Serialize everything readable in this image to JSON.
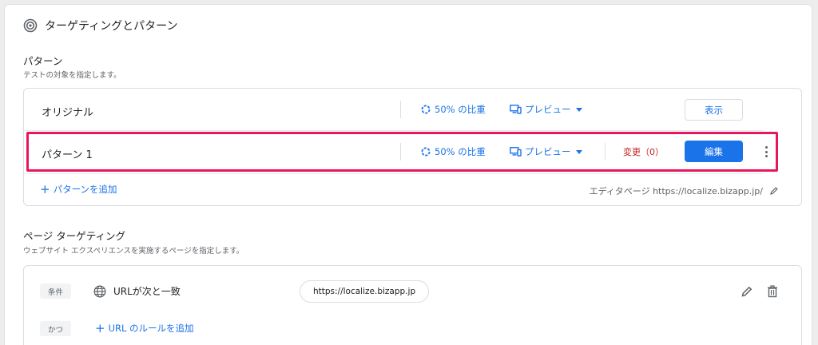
{
  "header": {
    "title": "ターゲティングとパターン",
    "icon": "target-icon"
  },
  "patterns_section": {
    "title": "パターン",
    "subtitle": "テストの対象を指定します。",
    "rows": [
      {
        "name": "オリジナル",
        "ratio": "50% の比重",
        "preview": "プレビュー",
        "action": "表示"
      },
      {
        "name": "パターン 1",
        "ratio": "50% の比重",
        "preview": "プレビュー",
        "change": "変更（0）",
        "action": "編集"
      }
    ],
    "add_pattern": "パターンを追加",
    "editor_page": "エディタページ https://localize.bizapp.jp/"
  },
  "page_targeting": {
    "title": "ページ ターゲティング",
    "subtitle": "ウェブサイト エクスペリエンスを実施するページを指定します。",
    "condition_chip": "条件",
    "condition_text": "URLが次と一致",
    "condition_value": "https://localize.bizapp.jp",
    "and_chip": "かつ",
    "add_url_rule": "URL のルールを追加"
  },
  "colors": {
    "accent": "#1a73e8",
    "highlight": "#e8175d",
    "change": "#c5221f"
  }
}
